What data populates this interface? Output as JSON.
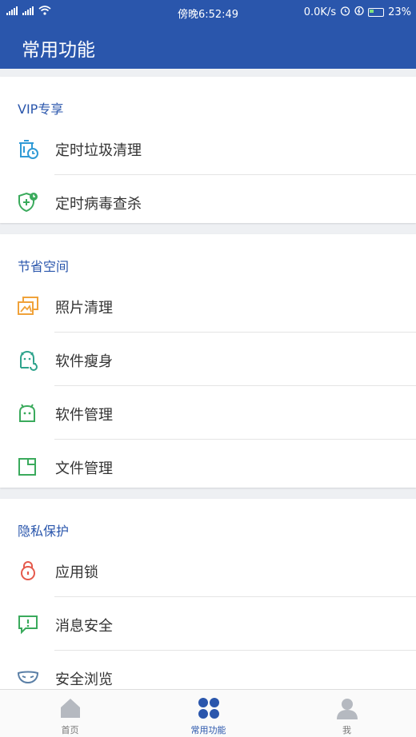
{
  "status_bar": {
    "signal1": "4G",
    "signal2": "4G",
    "time": "傍晚6:52:49",
    "network_speed": "0.0K/s",
    "battery": "23%"
  },
  "app_bar": {
    "title": "常用功能"
  },
  "sections": [
    {
      "title": "VIP专享",
      "items": [
        {
          "label": "定时垃圾清理",
          "icon": "scheduled-trash-icon"
        },
        {
          "label": "定时病毒查杀",
          "icon": "scheduled-virus-scan-icon"
        }
      ]
    },
    {
      "title": "节省空间",
      "items": [
        {
          "label": "照片清理",
          "icon": "photo-clean-icon"
        },
        {
          "label": "软件瘦身",
          "icon": "app-slim-icon"
        },
        {
          "label": "软件管理",
          "icon": "app-manage-icon"
        },
        {
          "label": "文件管理",
          "icon": "file-manage-icon"
        }
      ]
    },
    {
      "title": "隐私保护",
      "items": [
        {
          "label": "应用锁",
          "icon": "lock-icon"
        },
        {
          "label": "消息安全",
          "icon": "message-security-icon"
        },
        {
          "label": "安全浏览",
          "icon": "mask-icon"
        }
      ]
    }
  ],
  "bottom_nav": [
    {
      "label": "首页",
      "icon": "home-icon",
      "active": false
    },
    {
      "label": "常用功能",
      "icon": "grid-dots-icon",
      "active": true
    },
    {
      "label": "我",
      "icon": "profile-icon",
      "active": false
    }
  ],
  "colors": {
    "primary": "#2a56ac",
    "icon_blue": "#2f9ad6",
    "icon_green": "#3aaa5c",
    "icon_orange": "#f0a23a",
    "icon_teal": "#2ea38c",
    "icon_red": "#e55a4c",
    "icon_slate": "#5a7fa6"
  }
}
